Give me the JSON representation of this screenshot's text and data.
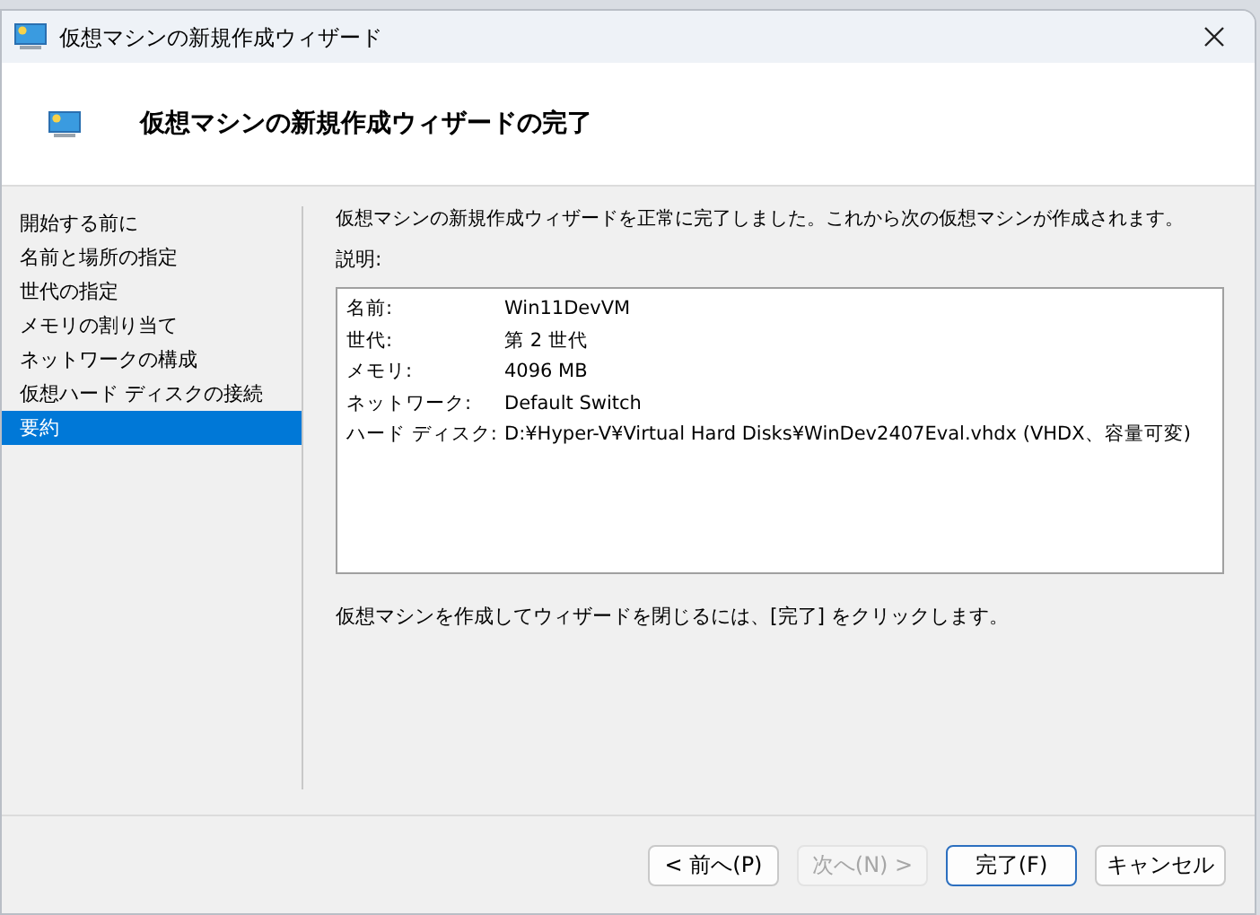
{
  "window": {
    "title": "仮想マシンの新規作成ウィザード"
  },
  "header": {
    "title": "仮想マシンの新規作成ウィザードの完了"
  },
  "steps": [
    {
      "label": "開始する前に",
      "selected": false
    },
    {
      "label": "名前と場所の指定",
      "selected": false
    },
    {
      "label": "世代の指定",
      "selected": false
    },
    {
      "label": "メモリの割り当て",
      "selected": false
    },
    {
      "label": "ネットワークの構成",
      "selected": false
    },
    {
      "label": "仮想ハード ディスクの接続",
      "selected": false
    },
    {
      "label": "要約",
      "selected": true
    }
  ],
  "intro": "仮想マシンの新規作成ウィザードを正常に完了しました。これから次の仮想マシンが作成されます。",
  "description_label": "説明:",
  "details": [
    {
      "label": "名前:",
      "value": "Win11DevVM"
    },
    {
      "label": "世代:",
      "value": "第 2 世代"
    },
    {
      "label": "メモリ:",
      "value": "4096 MB"
    },
    {
      "label": "ネットワーク:",
      "value": "Default Switch"
    },
    {
      "label": "ハード ディスク:",
      "value": "D:¥Hyper-V¥Virtual Hard Disks¥WinDev2407Eval.vhdx (VHDX、容量可変)"
    }
  ],
  "footer_note": "仮想マシンを作成してウィザードを閉じるには、[完了] をクリックします。",
  "buttons": [
    {
      "label": "< 前へ(P)",
      "disabled": false,
      "default": false
    },
    {
      "label": "次へ(N) >",
      "disabled": true,
      "default": false
    },
    {
      "label": "完了(F)",
      "disabled": false,
      "default": true
    },
    {
      "label": "キャンセル",
      "disabled": false,
      "default": false
    }
  ]
}
